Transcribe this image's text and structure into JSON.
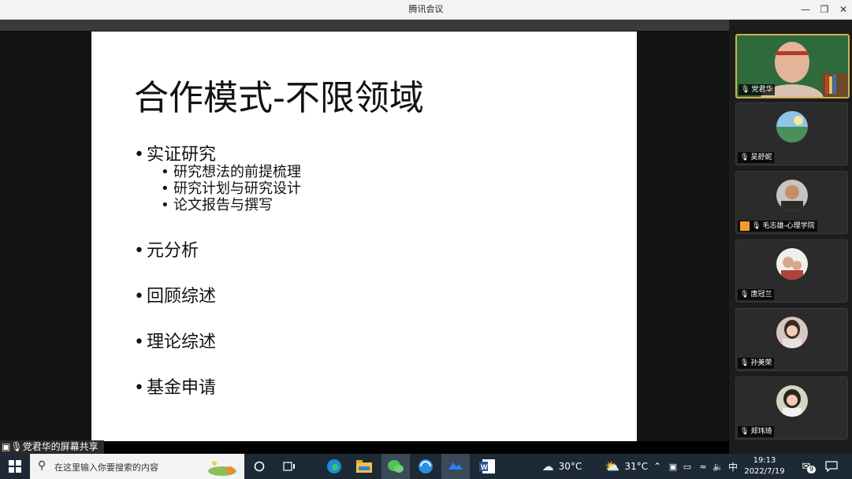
{
  "window": {
    "title": "腾讯会议",
    "minimize_icon": "minimize-icon",
    "restore_icon": "restore-icon",
    "close_icon": "close-icon"
  },
  "slide": {
    "title": "合作模式-不限领域",
    "bullets": [
      {
        "text": "实证研究",
        "subs": [
          "研究想法的前提梳理",
          "研究计划与研究设计",
          "论文报告与撰写"
        ]
      },
      {
        "text": "元分析"
      },
      {
        "text": "回顾综述"
      },
      {
        "text": "理论综述"
      },
      {
        "text": "基金申请"
      }
    ],
    "bullet_glyph": "•"
  },
  "share_label": "党君华的屏幕共享",
  "participants": [
    {
      "name": "党君华",
      "active": true
    },
    {
      "name": "吴舒妮"
    },
    {
      "name": "毛志雄-心理学院",
      "host": true
    },
    {
      "name": "唐冠兰"
    },
    {
      "name": "孙美荣"
    },
    {
      "name": "郑玮琦"
    }
  ],
  "taskbar": {
    "search_placeholder": "在这里输入你要搜索的内容",
    "weather1": "30°C",
    "weather2": "31°C",
    "ime": "中",
    "time": "19:13",
    "date": "2022/7/19",
    "notifications": "9"
  }
}
